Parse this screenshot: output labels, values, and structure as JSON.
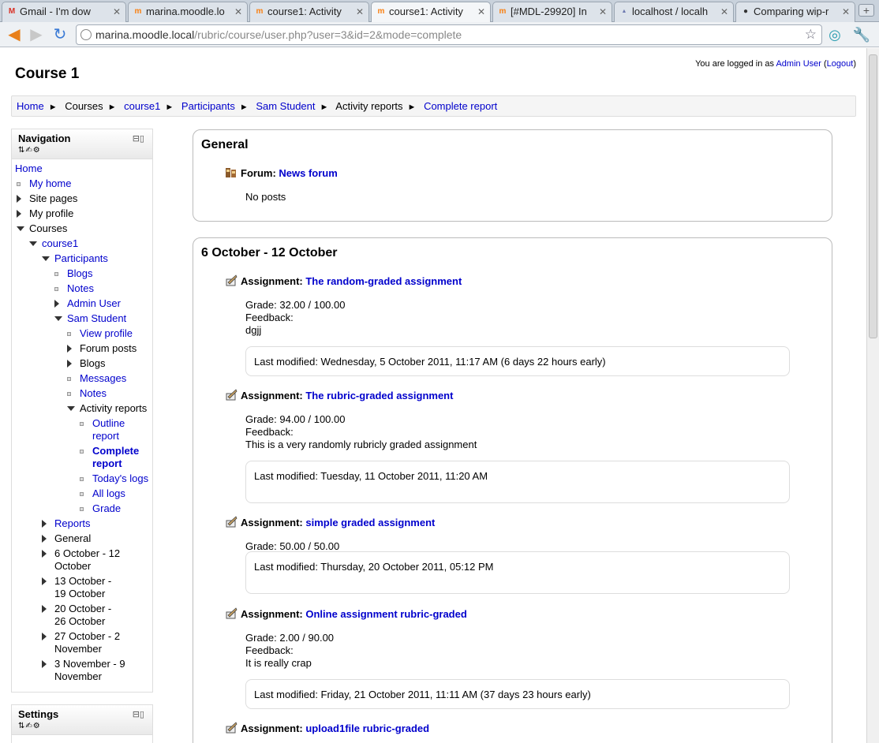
{
  "browser": {
    "tabs": [
      {
        "title": "Gmail - I'm dow",
        "favicon": "gmail-icon",
        "color": "#d93025"
      },
      {
        "title": "marina.moodle.lo",
        "favicon": "moodle-icon",
        "color": "#f98012"
      },
      {
        "title": "course1: Activity",
        "favicon": "moodle-icon",
        "color": "#f98012"
      },
      {
        "title": "course1: Activity",
        "favicon": "moodle-icon",
        "color": "#f98012",
        "active": true
      },
      {
        "title": "[#MDL-29920] In",
        "favicon": "moodle-tracker-icon",
        "color": "#f98012"
      },
      {
        "title": "localhost / localh",
        "favicon": "phpmyadmin-icon",
        "color": "#6c78af"
      },
      {
        "title": "Comparing wip-r",
        "favicon": "github-icon",
        "color": "#333333"
      }
    ],
    "url_host": "marina.moodle.local",
    "url_path": "/rubric/course/user.php?user=3&id=2&mode=complete"
  },
  "header": {
    "logged_in_prefix": "You are logged in as",
    "user": "Admin User",
    "logout": "Logout",
    "page_title": "Course 1"
  },
  "breadcrumb": [
    {
      "label": "Home",
      "link": true
    },
    {
      "label": "Courses",
      "link": false
    },
    {
      "label": "course1",
      "link": true
    },
    {
      "label": "Participants",
      "link": true
    },
    {
      "label": "Sam Student",
      "link": true
    },
    {
      "label": "Activity reports",
      "link": false
    },
    {
      "label": "Complete report",
      "link": true
    }
  ],
  "navigation": {
    "title": "Navigation",
    "items": [
      {
        "label": "Home",
        "level": 0,
        "type": "none",
        "link": true
      },
      {
        "label": "My home",
        "level": 1,
        "type": "bullet",
        "link": true
      },
      {
        "label": "Site pages",
        "level": 1,
        "type": "collapsed",
        "link": false
      },
      {
        "label": "My profile",
        "level": 1,
        "type": "collapsed",
        "link": false
      },
      {
        "label": "Courses",
        "level": 1,
        "type": "expanded",
        "link": false
      },
      {
        "label": "course1",
        "level": 2,
        "type": "expanded",
        "link": true
      },
      {
        "label": "Participants",
        "level": 3,
        "type": "expanded",
        "link": true
      },
      {
        "label": "Blogs",
        "level": 4,
        "type": "bullet",
        "link": true
      },
      {
        "label": "Notes",
        "level": 4,
        "type": "bullet",
        "link": true
      },
      {
        "label": "Admin User",
        "level": 4,
        "type": "collapsed",
        "link": true
      },
      {
        "label": "Sam Student",
        "level": 4,
        "type": "expanded",
        "link": true
      },
      {
        "label": "View profile",
        "level": 5,
        "type": "bullet",
        "link": true
      },
      {
        "label": "Forum posts",
        "level": 5,
        "type": "collapsed",
        "link": false
      },
      {
        "label": "Blogs",
        "level": 5,
        "type": "collapsed",
        "link": false
      },
      {
        "label": "Messages",
        "level": 5,
        "type": "bullet",
        "link": true
      },
      {
        "label": "Notes",
        "level": 5,
        "type": "bullet",
        "link": true
      },
      {
        "label": "Activity reports",
        "level": 5,
        "type": "expanded",
        "link": false
      },
      {
        "label": "Outline report",
        "level": 6,
        "type": "bullet",
        "link": true
      },
      {
        "label": "Complete report",
        "level": 6,
        "type": "bullet",
        "link": true,
        "bold": true
      },
      {
        "label": "Today's logs",
        "level": 6,
        "type": "bullet",
        "link": true
      },
      {
        "label": "All logs",
        "level": 6,
        "type": "bullet",
        "link": true
      },
      {
        "label": "Grade",
        "level": 6,
        "type": "bullet",
        "link": true
      },
      {
        "label": "Reports",
        "level": 3,
        "type": "collapsed",
        "link": true
      },
      {
        "label": "General",
        "level": 3,
        "type": "collapsed",
        "link": false
      },
      {
        "label": "6 October - 12 October",
        "level": 3,
        "type": "collapsed",
        "link": false
      },
      {
        "label": "13 October - 19 October",
        "level": 3,
        "type": "collapsed",
        "link": false
      },
      {
        "label": "20 October - 26 October",
        "level": 3,
        "type": "collapsed",
        "link": false
      },
      {
        "label": "27 October - 2 November",
        "level": 3,
        "type": "collapsed",
        "link": false
      },
      {
        "label": "3 November - 9 November",
        "level": 3,
        "type": "collapsed",
        "link": false
      }
    ]
  },
  "settings": {
    "title": "Settings"
  },
  "sections": [
    {
      "title": "General",
      "activities": [
        {
          "type_label": "Forum:",
          "name": "News forum",
          "details": [
            "No posts"
          ]
        }
      ]
    },
    {
      "title": "6 October - 12 October",
      "activities": [
        {
          "type_label": "Assignment:",
          "name": "The random-graded assignment",
          "details": [
            "Grade: 32.00 / 100.00",
            "Feedback:",
            "dgjj"
          ],
          "modified": "Last modified: Wednesday, 5 October 2011, 11:17 AM (6 days 22 hours early)"
        },
        {
          "type_label": "Assignment:",
          "name": "The rubric-graded assignment",
          "details": [
            "Grade: 94.00 / 100.00",
            "Feedback:",
            "This is a very randomly rubricly graded assignment"
          ],
          "modified": "Last modified: Tuesday, 11 October 2011, 11:20 AM"
        },
        {
          "type_label": "Assignment:",
          "name": "simple graded assignment",
          "details": [
            "Grade: 50.00 / 50.00"
          ],
          "modified": "Last modified: Thursday, 20 October 2011, 05:12 PM"
        },
        {
          "type_label": "Assignment:",
          "name": "Online assignment rubric-graded",
          "details": [
            "Grade: 2.00 / 90.00",
            "Feedback:",
            "It is really crap"
          ],
          "modified": "Last modified: Friday, 21 October 2011, 11:11 AM (37 days 23 hours early)"
        },
        {
          "type_label": "Assignment:",
          "name": "upload1file rubric-graded",
          "details": []
        }
      ]
    }
  ]
}
